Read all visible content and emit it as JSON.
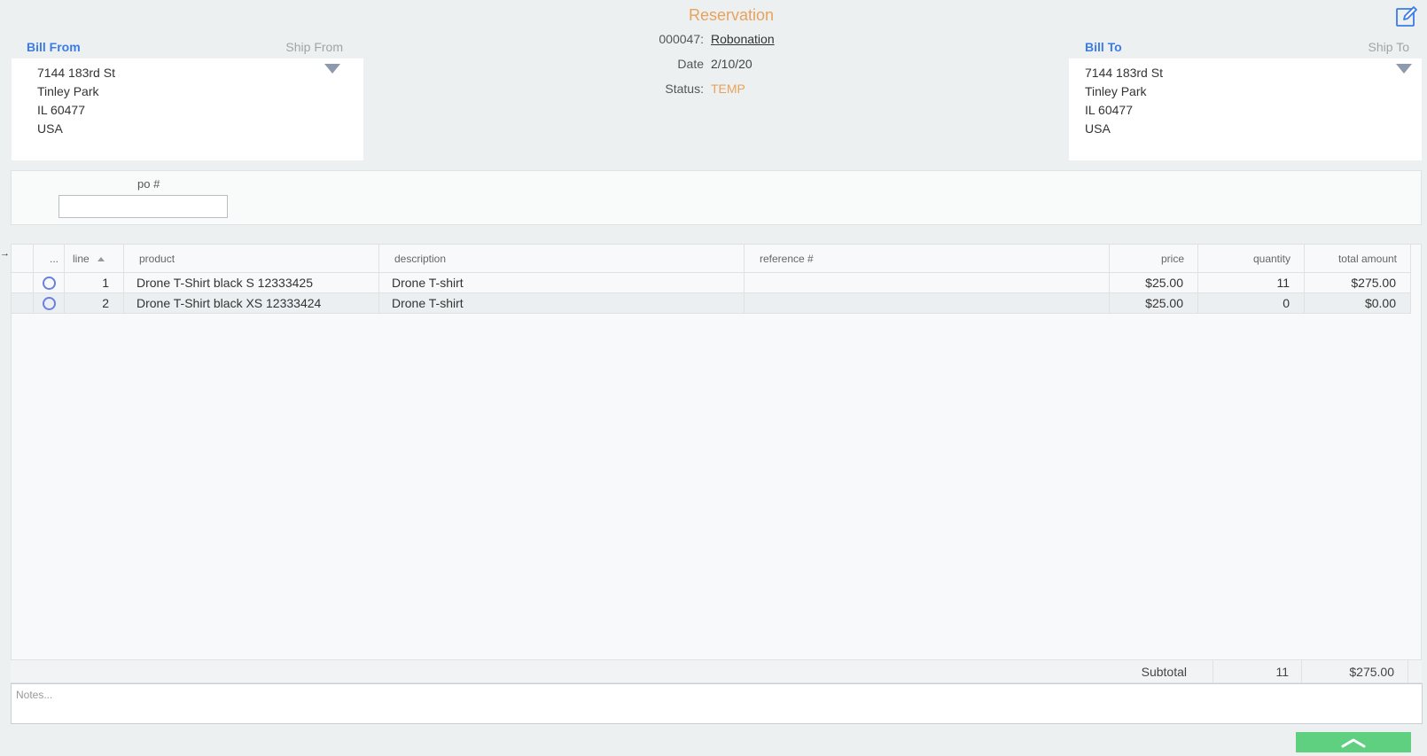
{
  "header": {
    "title": "Reservation",
    "title_color": "#e8a25c",
    "number_label": "000047:",
    "customer_link": "Robonation",
    "date_label": "Date",
    "date_value": "2/10/20",
    "status_label": "Status:",
    "status_value": "TEMP",
    "status_color": "#e8a25c",
    "edit_icon": "edit-icon"
  },
  "bill_from": {
    "label": "Bill From",
    "alt_label": "Ship From",
    "label_color": "#3b7be8",
    "address": [
      "7144 183rd St",
      "Tinley Park",
      "IL 60477",
      "USA"
    ]
  },
  "bill_to": {
    "label": "Bill To",
    "alt_label": "Ship To",
    "label_color": "#3b7be8",
    "address": [
      "7144 183rd St",
      "Tinley Park",
      "IL 60477",
      "USA"
    ]
  },
  "po": {
    "label": "po #",
    "value": ""
  },
  "grid": {
    "columns": {
      "menu": "...",
      "line": "line",
      "product": "product",
      "description": "description",
      "reference": "reference #",
      "price": "price",
      "quantity": "quantity",
      "total": "total amount"
    },
    "sort_icon": "sort-asc-icon",
    "rows": [
      {
        "line": "1",
        "product": "Drone T-Shirt black S 12333425",
        "description": "Drone T-shirt",
        "reference": "",
        "price": "$25.00",
        "quantity": "11",
        "total": "$275.00"
      },
      {
        "line": "2",
        "product": "Drone T-Shirt black XS 12333424",
        "description": "Drone T-shirt",
        "reference": "",
        "price": "$25.00",
        "quantity": "0",
        "total": "$0.00"
      }
    ]
  },
  "subtotal": {
    "label": "Subtotal",
    "quantity": "11",
    "total": "$275.00"
  },
  "notes": {
    "placeholder": "Notes...",
    "value": ""
  },
  "collapse_button": {
    "icon": "chevron-up-icon",
    "color": "#5fcf80"
  }
}
